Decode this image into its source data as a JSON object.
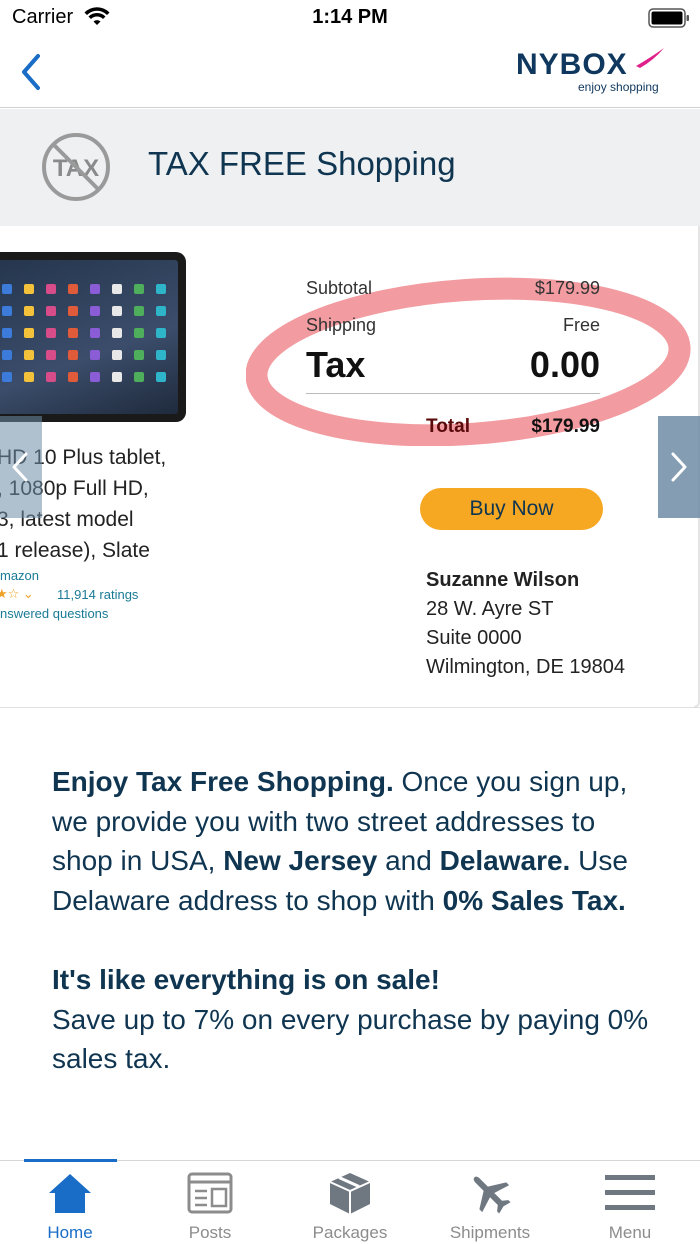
{
  "status_bar": {
    "carrier": "Carrier",
    "time": "1:14 PM"
  },
  "nav": {
    "back_icon": "chevron-left-icon",
    "logo_name": "NYBOX",
    "logo_tagline": "enjoy shopping"
  },
  "banner": {
    "icon": "no-tax-icon",
    "title_bold": "TAX FREE",
    "title_rest": " Shopping"
  },
  "carousel": {
    "product": {
      "lines": [
        "HD 10 Plus tablet,",
        ", 1080p Full HD,",
        "3, latest model",
        "1 release), Slate"
      ],
      "brand": "mazon",
      "rating_count": "11,914 ratings",
      "answered": "nswered questions"
    },
    "receipt": {
      "subtotal_label": "Subtotal",
      "subtotal_value": "$179.99",
      "shipping_label": "Shipping",
      "shipping_value": "Free",
      "tax_label": "Tax",
      "tax_value": "0.00",
      "total_label": "Total",
      "total_value": "$179.99"
    },
    "buy_button": "Buy Now",
    "address": {
      "name": "Suzanne Wilson",
      "line1": "28 W. Ayre ST",
      "line2": "Suite 0000",
      "line3": "Wilmington, DE 19804"
    },
    "highlight_color": "#f08a8f"
  },
  "copy": {
    "p1_bold1": "Enjoy Tax Free Shopping.",
    "p1_text1": " Once you sign up, we provide you with two street addresses to shop in USA, ",
    "p1_bold2": "New Jersey",
    "p1_text2": " and ",
    "p1_bold3": "Delaware.",
    "p1_text3": " Use Delaware address to shop with ",
    "p1_bold4": "0% Sales Tax.",
    "p2_bold": "It's like everything is on sale!",
    "p2_text": "Save up to 7% on every purchase by paying 0% sales tax."
  },
  "tabs": [
    {
      "label": "Home",
      "icon": "home-icon",
      "active": true
    },
    {
      "label": "Posts",
      "icon": "posts-icon",
      "active": false
    },
    {
      "label": "Packages",
      "icon": "package-icon",
      "active": false
    },
    {
      "label": "Shipments",
      "icon": "airplane-icon",
      "active": false
    },
    {
      "label": "Menu",
      "icon": "menu-icon",
      "active": false
    }
  ],
  "colors": {
    "brand": "#0f3551",
    "accent": "#1a6dc7",
    "button": "#f7a823"
  }
}
